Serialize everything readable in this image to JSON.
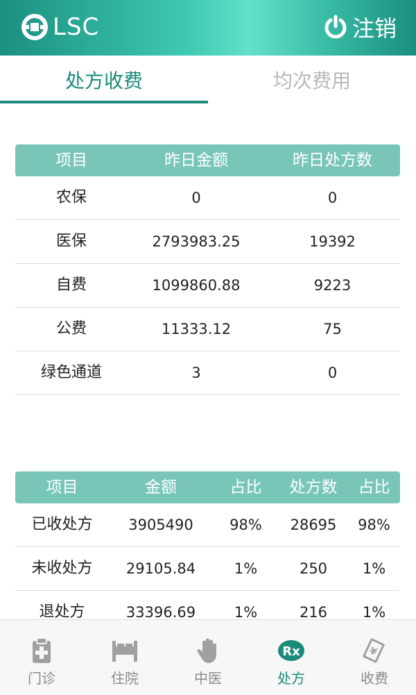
{
  "header": {
    "logo_text": "LSC",
    "logout_label": "注销",
    "brand_color": "#2ab59e"
  },
  "tabs": [
    {
      "label": "处方收费",
      "active": true
    },
    {
      "label": "均次费用",
      "active": false
    }
  ],
  "table1": {
    "headers": [
      "项目",
      "昨日金额",
      "昨日处方数"
    ],
    "rows": [
      [
        "农保",
        "0",
        "0"
      ],
      [
        "医保",
        "2793983.25",
        "19392"
      ],
      [
        "自费",
        "1099860.88",
        "9223"
      ],
      [
        "公费",
        "11333.12",
        "75"
      ],
      [
        "绿色通道",
        "3",
        "0"
      ]
    ]
  },
  "table2": {
    "headers": [
      "项目",
      "金额",
      "占比",
      "处方数",
      "占比"
    ],
    "rows": [
      [
        "已收处方",
        "3905490",
        "98%",
        "28695",
        "98%"
      ],
      [
        "未收处方",
        "29105.84",
        "1%",
        "250",
        "1%"
      ],
      [
        "退处方",
        "33396.69",
        "1%",
        "216",
        "1%"
      ]
    ]
  },
  "bottom_nav": [
    {
      "label": "门诊",
      "icon": "clipboard-plus-icon",
      "active": false
    },
    {
      "label": "住院",
      "icon": "bed-icon",
      "active": false
    },
    {
      "label": "中医",
      "icon": "hand-icon",
      "active": false
    },
    {
      "label": "处方",
      "icon": "rx-icon",
      "active": true
    },
    {
      "label": "收费",
      "icon": "yuan-bill-icon",
      "active": false
    }
  ]
}
